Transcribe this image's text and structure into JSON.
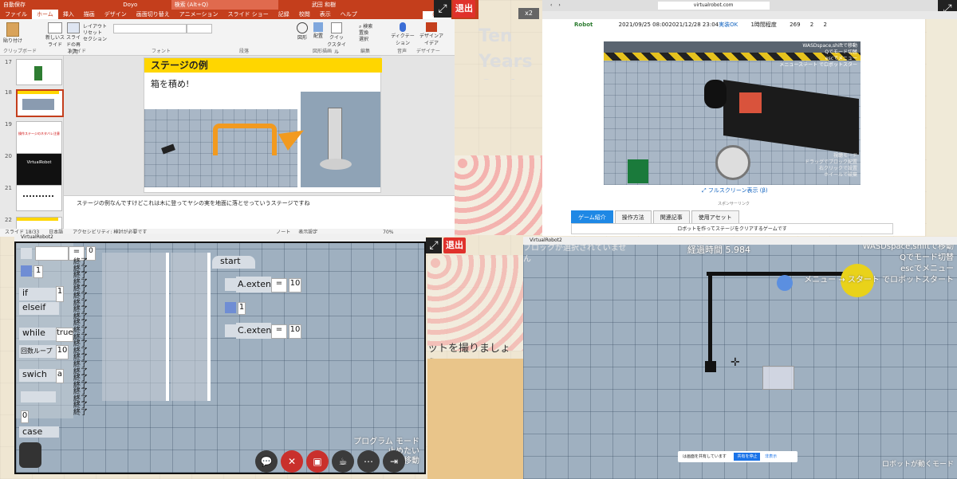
{
  "meeting": {
    "exit_label": "退出",
    "fullscreen_icon": "expand-icon",
    "zoom_badge": "x2",
    "share_note": "は画面を共有しています",
    "share_stop": "共有を停止",
    "share_hide": "非表示",
    "center_text": "ットを撮りましょう！"
  },
  "ppt": {
    "title": "自動保存",
    "doc": "Doyo",
    "search": "検索 (Alt+Q)",
    "user": "武田 和樹",
    "share_btn": "共有",
    "tabs": [
      "ファイル",
      "ホーム",
      "挿入",
      "描画",
      "デザイン",
      "画面切り替え",
      "アニメーション",
      "スライド ショー",
      "記録",
      "校閲",
      "表示",
      "ヘルプ"
    ],
    "active_tab": "ホーム",
    "ribbon": {
      "paste": "貼り付け",
      "clipboard": "クリップボード",
      "new_slide": "新しいスライド",
      "reuse": "スライドの再利用",
      "layout": "レイアウト",
      "reset": "リセット",
      "section": "セクション",
      "slides_group": "スライド",
      "font_group": "フォント",
      "paragraph_group": "段落",
      "shape": "図形",
      "arrange": "配置",
      "quick_style": "クイックスタイル",
      "drawing_group": "図形描画",
      "find": "検索",
      "replace": "置換",
      "select": "選択",
      "edit_group": "編集",
      "dictate": "ディクテーション",
      "voice_group": "音声",
      "design_ideas": "デザインアイデア",
      "designer_group": "デザイナー"
    },
    "slide_numbers": [
      "17",
      "18",
      "19",
      "20",
      "21",
      "22"
    ],
    "thumb19_text": "操作ステージのネタバレ注意",
    "thumb20_text": "VirtualRobot",
    "slide_title": "ステージの例",
    "slide_subtitle": "箱を積め!",
    "notes": "ステージの例なんですけどこれは木に登ってヤシの実を地面に落とせっていうステージですね",
    "status_slide": "スライド 18/33",
    "status_lang": "日本語",
    "status_access": "アクセシビリティ: 検討が必要です",
    "status_notes": "ノート",
    "status_view": "表示設定",
    "status_zoom": "70%"
  },
  "editor": {
    "title": "VirtualRobot2",
    "palette": {
      "assign_op": "=",
      "assign_val": "0",
      "wait_val": "1",
      "if_label": "if",
      "if_val": "1",
      "elseif_label": "elseif",
      "while_label": "while",
      "while_val": "true",
      "loop_label": "回数ループ",
      "loop_val": "10",
      "switch_label": "swich",
      "switch_val": "a",
      "case_val": "0",
      "case_label": "case"
    },
    "end_items": [
      "終了",
      "終了",
      "終了",
      "終了",
      "終了",
      "終了",
      "終了",
      "終了",
      "終了",
      "終了",
      "終了",
      "終了",
      "終了",
      "終了",
      "終了",
      "終了",
      "終了",
      "終了",
      "終了",
      "終了",
      "終了",
      "終了",
      "終了"
    ],
    "program": {
      "start_label": "start",
      "b1_var": "A.extend",
      "b1_op": "=",
      "b1_val": "10",
      "wait_val": "1",
      "b3_var": "C.extend",
      "b3_op": "=",
      "b3_val": "10"
    },
    "hud": {
      "line1": "プログラム モード",
      "line2": "止めたい",
      "line3": "移動"
    },
    "tools": [
      "chat-icon",
      "mic-off-icon",
      "video-off-icon",
      "coffee-icon",
      "more-icon",
      "leave-icon"
    ]
  },
  "browser": {
    "url": "virtualrobot.com",
    "row": {
      "title": "Robot",
      "start": "2021/09/25 08:00",
      "end": "2021/12/28 23:04",
      "status": "実装OK",
      "length": "1時間程度",
      "count": "269",
      "a": "2",
      "b": "2"
    },
    "video_overlay": [
      "WASDspace,shiftで移動",
      "Qでモード切替",
      "escでメニュー",
      "メニューステート でロボットスター"
    ],
    "video_right": [
      "視聴モード",
      "ドラッグでブロック配置",
      "右クリックで設置",
      "ホイールで破棄"
    ],
    "fullscreen_link": "フルスクリーン表示 (β)",
    "sponsor": "スポンサーリンク",
    "tabs": [
      "ゲーム紹介",
      "操作方法",
      "関連記事",
      "使用アセット"
    ],
    "active_tab": "ゲーム紹介",
    "description": "ロボットを作ってステージをクリアするゲームです",
    "bg_text": "Ten Years Coder"
  },
  "sim": {
    "title": "VirtualRobot2",
    "left_msg": "ブロックが選択されていません",
    "elapsed": "経過時間 5.984",
    "controls": [
      "WASDspace,shiftで移動",
      "Qでモード切替",
      "escでメニュー",
      "メニュー → スタート でロボットスタート"
    ],
    "bottom_right": "ロボットが動くモード"
  }
}
